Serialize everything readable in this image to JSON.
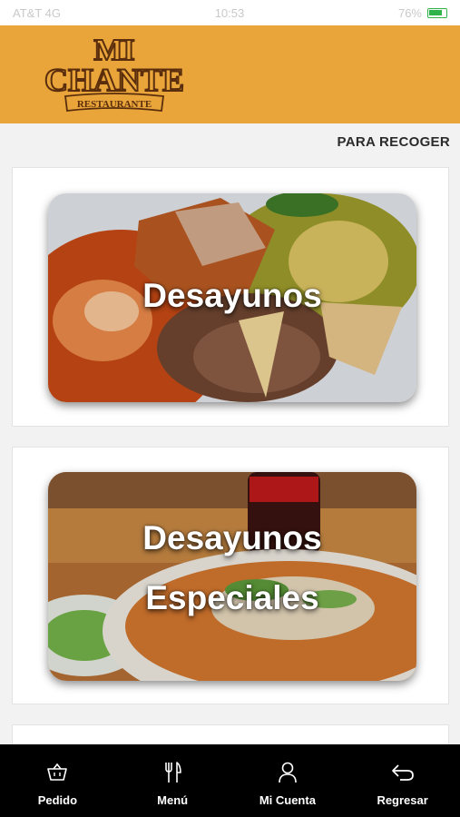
{
  "status": {
    "time_left": "AT&T 4G",
    "time": "10:53",
    "battery": "76%"
  },
  "brand": {
    "line1": "MI",
    "line2": "CHANTE",
    "line3": "RESTAURANTE"
  },
  "header": {
    "pickup_label": "PARA RECOGER"
  },
  "categories": [
    {
      "title": "Desayunos"
    },
    {
      "title_line1": "Desayunos",
      "title_line2": "Especiales"
    }
  ],
  "tabbar": {
    "items": [
      {
        "label": "Pedido",
        "icon": "basket-icon"
      },
      {
        "label": "Menú",
        "icon": "fork-knife-icon"
      },
      {
        "label": "Mi Cuenta",
        "icon": "user-icon"
      },
      {
        "label": "Regresar",
        "icon": "back-arrow-icon"
      }
    ]
  },
  "colors": {
    "header_bg": "#e9a53a",
    "tabbar_bg": "#000000",
    "page_bg": "#f2f2f2"
  }
}
